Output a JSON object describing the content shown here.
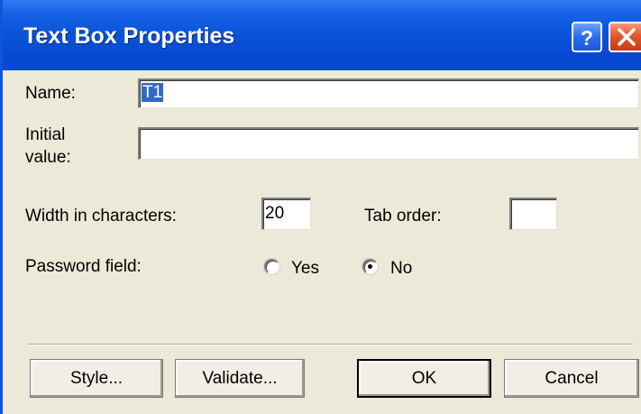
{
  "window": {
    "title": "Text Box Properties",
    "help_label": "?",
    "close_label": "×"
  },
  "form": {
    "name_label": "Name:",
    "name_value": "T1",
    "initial_label_line1": "Initial",
    "initial_label_line2": "value:",
    "initial_value": "",
    "width_label": "Width in characters:",
    "width_value": "20",
    "taborder_label": "Tab order:",
    "taborder_value": "",
    "password_label": "Password field:",
    "password_yes_label": "Yes",
    "password_no_label": "No",
    "password_selected": "No"
  },
  "buttons": {
    "style_label": "Style...",
    "validate_label": "Validate...",
    "ok_label": "OK",
    "cancel_label": "Cancel"
  },
  "colors": {
    "titlebar": "#0a55da",
    "dialog_bg": "#ece9d8",
    "selection": "#316ac5"
  }
}
